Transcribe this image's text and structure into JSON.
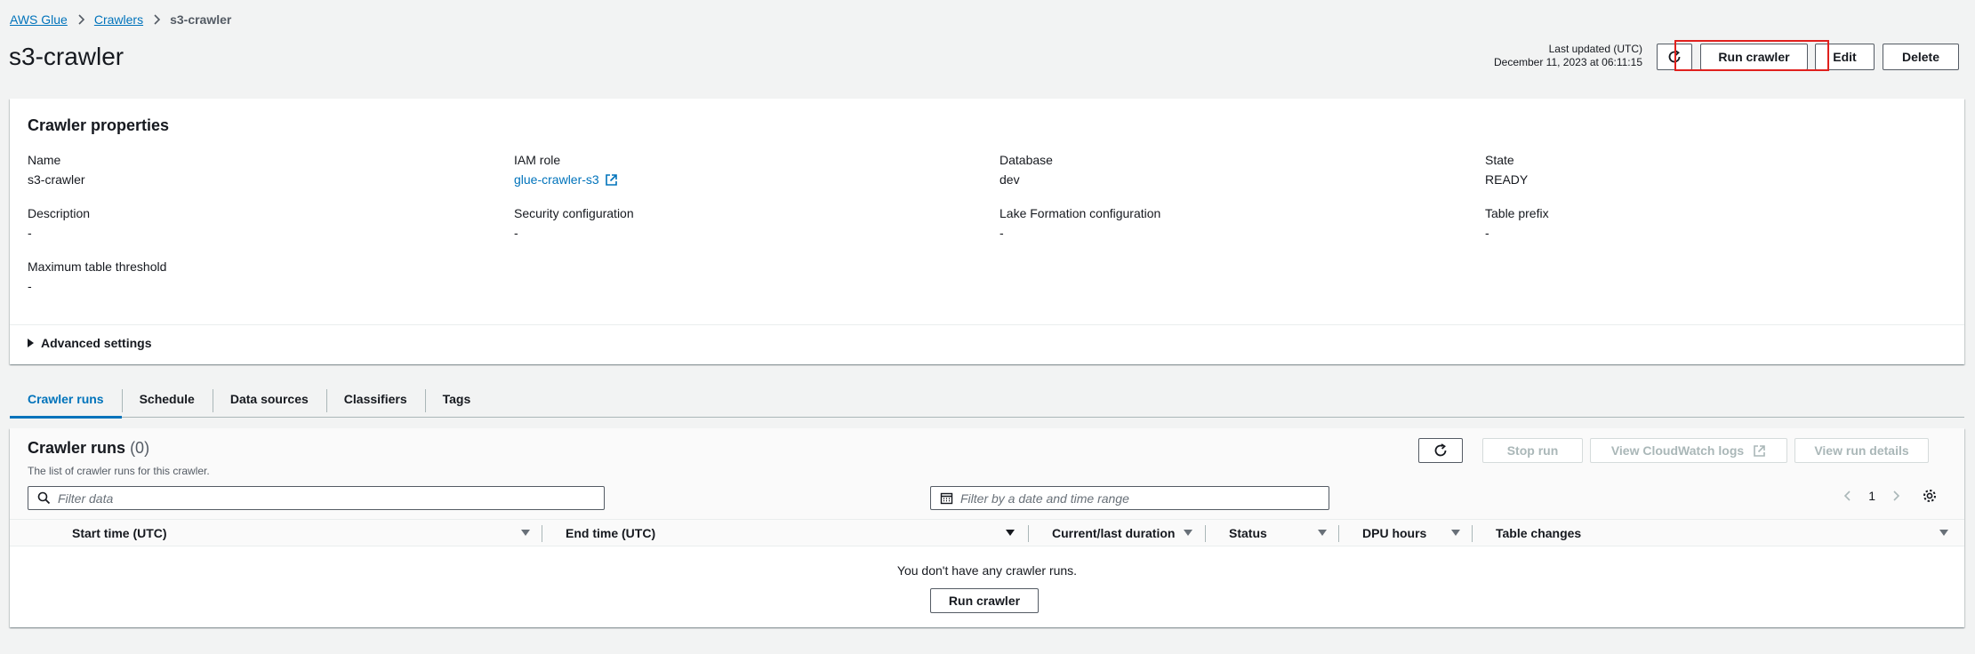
{
  "breadcrumb": {
    "root": "AWS Glue",
    "parent": "Crawlers",
    "current": "s3-crawler"
  },
  "page": {
    "title": "s3-crawler"
  },
  "header": {
    "last_updated_label": "Last updated (UTC)",
    "last_updated_value": "December 11, 2023 at 06:11:15",
    "run_label": "Run crawler",
    "edit_label": "Edit",
    "delete_label": "Delete",
    "refresh_icon": "refresh-icon"
  },
  "properties": {
    "title": "Crawler properties",
    "name": {
      "label": "Name",
      "value": "s3-crawler"
    },
    "iam_role": {
      "label": "IAM role",
      "value": "glue-crawler-s3"
    },
    "database": {
      "label": "Database",
      "value": "dev"
    },
    "state": {
      "label": "State",
      "value": "READY"
    },
    "description": {
      "label": "Description",
      "value": "-"
    },
    "security": {
      "label": "Security configuration",
      "value": "-"
    },
    "lake_formation": {
      "label": "Lake Formation configuration",
      "value": "-"
    },
    "table_prefix": {
      "label": "Table prefix",
      "value": "-"
    },
    "max_threshold": {
      "label": "Maximum table threshold",
      "value": "-"
    },
    "advanced": "Advanced settings"
  },
  "tabs": [
    {
      "label": "Crawler runs",
      "active": true
    },
    {
      "label": "Schedule"
    },
    {
      "label": "Data sources"
    },
    {
      "label": "Classifiers"
    },
    {
      "label": "Tags"
    }
  ],
  "runs": {
    "title": "Crawler runs",
    "count": "(0)",
    "description": "The list of crawler runs for this crawler.",
    "stop_label": "Stop run",
    "cloudwatch_label": "View CloudWatch logs",
    "details_label": "View run details",
    "filter_placeholder": "Filter data",
    "date_placeholder": "Filter by a date and time range",
    "page": "1",
    "columns": [
      "Start time (UTC)",
      "End time (UTC)",
      "Current/last duration",
      "Status",
      "DPU hours",
      "Table changes"
    ],
    "empty_text": "You don't have any crawler runs.",
    "empty_button": "Run crawler"
  },
  "colors": {
    "accent": "#0073bb",
    "highlight": "#e0201d"
  }
}
